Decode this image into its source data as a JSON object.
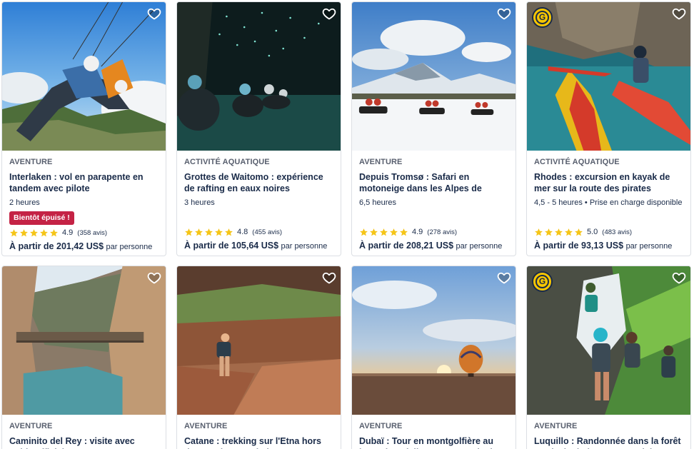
{
  "cards": [
    {
      "category": "AVENTURE",
      "title": "Interlaken : vol en parapente en tandem avec pilote",
      "duration": "2 heures",
      "flag": "Bientôt épuisé !",
      "score": "4.9",
      "reviews": "(358 avis)",
      "price_prefix": "À partir de",
      "price": "201,42 US$",
      "price_suffix": "par personne"
    },
    {
      "category": "ACTIVITÉ AQUATIQUE",
      "title": "Grottes de Waitomo : expérience de rafting en eaux noires",
      "duration": "3 heures",
      "score": "4.8",
      "reviews": "(455 avis)",
      "price_prefix": "À partir de",
      "price": "105,64 US$",
      "price_suffix": "par personne"
    },
    {
      "category": "AVENTURE",
      "title": "Depuis Tromsø : Safari en motoneige dans les Alpes de Lyngen",
      "duration": "6,5 heures",
      "score": "4.9",
      "reviews": "(278 avis)",
      "price_prefix": "À partir de",
      "price": "208,21 US$",
      "price_suffix": "par personne"
    },
    {
      "category": "ACTIVITÉ AQUATIQUE",
      "title": "Rhodes : excursion en kayak de mer sur la route des pirates",
      "duration": "4,5 - 5 heures • Prise en charge disponible",
      "score": "5.0",
      "reviews": "(483 avis)",
      "price_prefix": "À partir de",
      "price": "93,13 US$",
      "price_suffix": "par personne",
      "badge": "G"
    },
    {
      "category": "AVENTURE",
      "title": "Caminito del Rey : visite avec guide officiel"
    },
    {
      "category": "AVENTURE",
      "title": "Catane : trekking sur l'Etna hors des sentiers touristiques"
    },
    {
      "category": "AVENTURE",
      "title": "Dubaï : Tour en montgolfière au lever du soleil avec navette incluse"
    },
    {
      "category": "AVENTURE",
      "title": "Luquillo : Randonnée dans la forêt tropicale d'El Yunque et visite",
      "badge": "G"
    }
  ],
  "colors": {
    "text": "#1a2b49",
    "category": "#585f6e",
    "soldout": "#c42345",
    "star": "#f5c518",
    "badge": "#f7c600"
  }
}
